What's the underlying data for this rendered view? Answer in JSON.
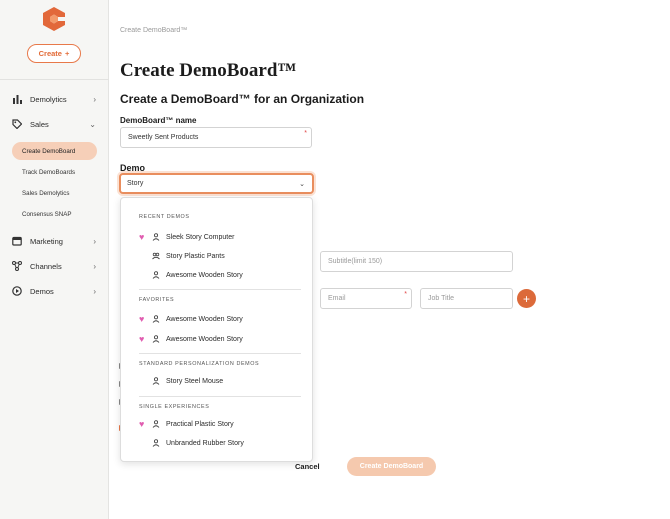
{
  "sidebar": {
    "create_label": "Create",
    "items": [
      {
        "label": "Demolytics",
        "icon": "bar-chart-icon"
      },
      {
        "label": "Sales",
        "icon": "tag-icon"
      },
      {
        "label": "Marketing",
        "icon": "calendar-icon"
      },
      {
        "label": "Channels",
        "icon": "channels-icon"
      },
      {
        "label": "Demos",
        "icon": "play-icon"
      }
    ],
    "sales_subitems": {
      "active": "Create DemoBoard",
      "others": [
        "Track DemoBoards",
        "Sales Demolytics",
        "Consensus SNAP"
      ]
    }
  },
  "main": {
    "breadcrumb": "Create DemoBoard™",
    "page_title": "Create DemoBoard™",
    "section_title": "Create a DemoBoard™ for an Organization",
    "name_label": "DemoBoard™ name",
    "name_value": "Sweetly Sent Products",
    "demo_label": "Demo",
    "demo_value": "Story",
    "subtitle_placeholder": "Subtitle(limit 150)",
    "email_placeholder": "Email",
    "jobtitle_placeholder": "Job Title",
    "cancel_label": "Cancel",
    "submit_label": "Create DemoBoard"
  },
  "dropdown": {
    "groups": [
      {
        "title": "RECENT DEMOS",
        "items": [
          {
            "label": "Sleek Story Computer",
            "favorite": true,
            "icon": "person-icon"
          },
          {
            "label": "Story Plastic Pants",
            "favorite": false,
            "icon": "group-icon"
          },
          {
            "label": "Awesome Wooden Story",
            "favorite": false,
            "icon": "person-icon"
          }
        ]
      },
      {
        "title": "FAVORITES",
        "items": [
          {
            "label": "Awesome Wooden Story",
            "favorite": true,
            "icon": "person-icon"
          },
          {
            "label": "Awesome Wooden Story",
            "favorite": true,
            "icon": "person-icon"
          }
        ]
      },
      {
        "title": "STANDARD PERSONALIZATION DEMOS",
        "items": [
          {
            "label": "Story Steel Mouse",
            "favorite": false,
            "icon": "person-icon"
          }
        ]
      },
      {
        "title": "SINGLE EXPERIENCES",
        "items": [
          {
            "label": "Practical Plastic Story",
            "favorite": true,
            "icon": "person-icon"
          },
          {
            "label": "Unbranded Rubber Story",
            "favorite": false,
            "icon": "person-icon"
          }
        ]
      }
    ]
  },
  "colors": {
    "accent": "#dc6a3a",
    "accent_light": "#f6cfb8",
    "heart": "#e05db0"
  }
}
